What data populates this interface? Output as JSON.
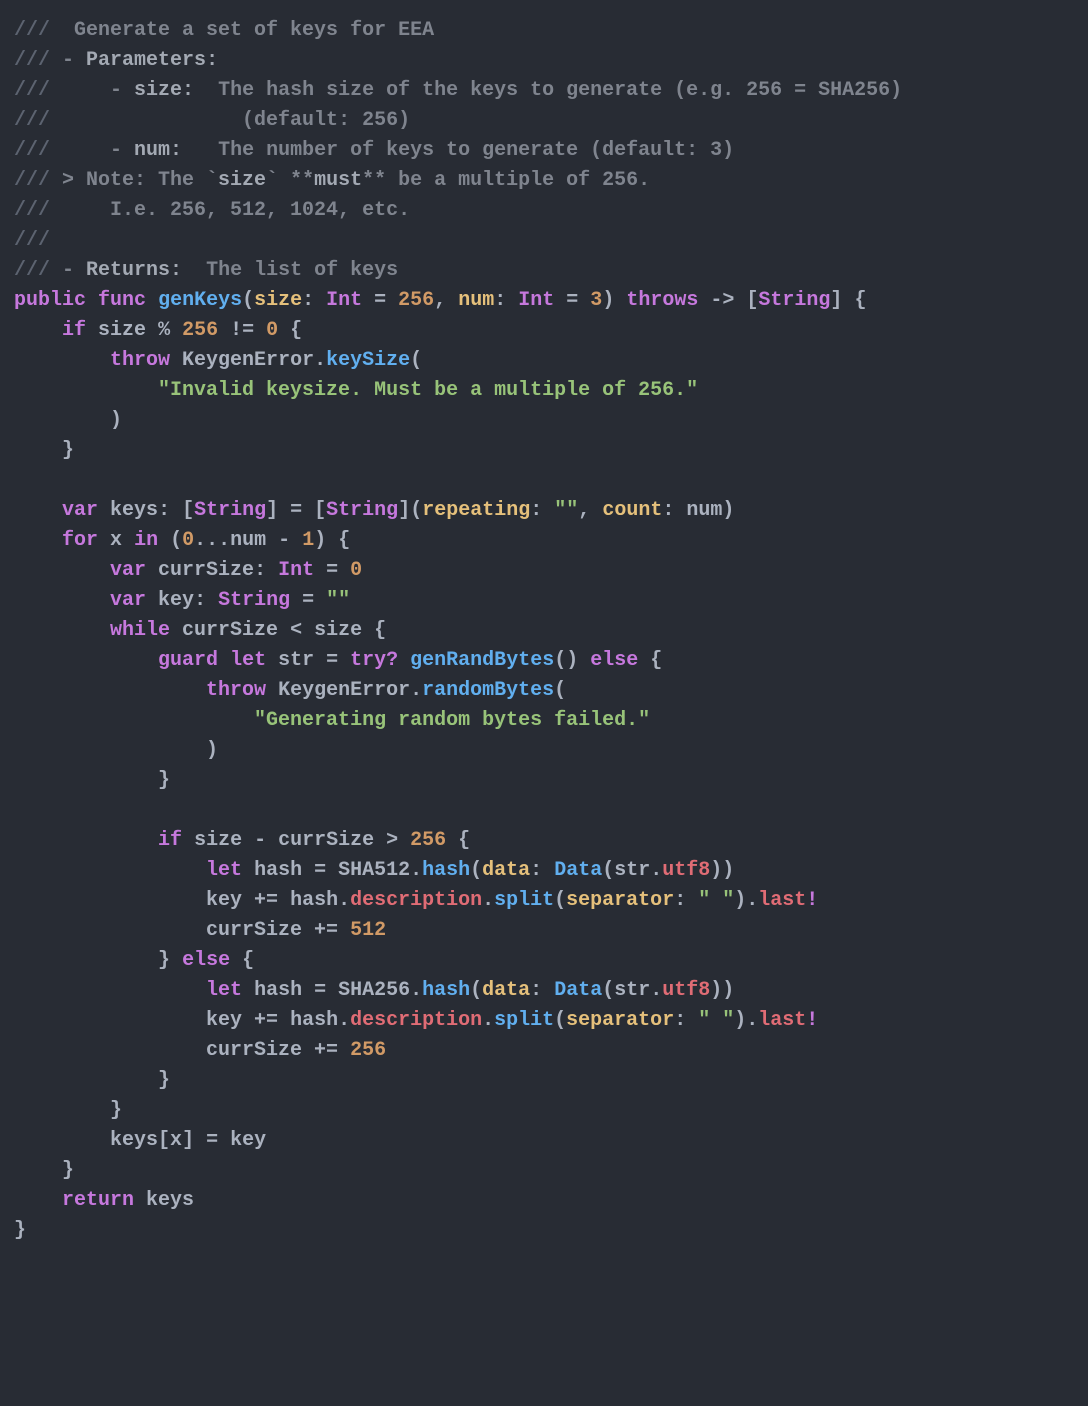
{
  "doc": {
    "l1": "  Generate a set of keys for EEA",
    "l2_dash": " - ",
    "l2_label": "Parameters",
    "l2_colon": ":",
    "l3_pre": "     - ",
    "l3_name": "size",
    "l3_colon": ":",
    "l3_desc": "  The hash size of the keys to generate (e.g. 256 = SHA256)",
    "l4_desc": "                (default: 256)",
    "l5_pre": "     - ",
    "l5_name": "num",
    "l5_colon": ":",
    "l5_desc": "   The number of keys to generate (default: 3)",
    "l6_a": " > Note: The `",
    "l6_size": "size",
    "l6_b": "` **",
    "l6_must": "must",
    "l6_c": "** be a multiple of 256.",
    "l7": "     I.e. 256, 512, 1024, etc.",
    "l9_dash": " - ",
    "l9_label": "Returns",
    "l9_colon": ":",
    "l9_desc": "  The list of keys"
  },
  "kw": {
    "public": "public",
    "func": "func",
    "Int": "Int",
    "throws": "throws",
    "String": "String",
    "if": "if",
    "throw": "throw",
    "var": "var",
    "for": "for",
    "in": "in",
    "while": "while",
    "guard": "guard",
    "let": "let",
    "try": "try",
    "else": "else",
    "return": "return"
  },
  "fn": {
    "genKeys": "genKeys",
    "keySize": "keySize",
    "genRandBytes": "genRandBytes",
    "randomBytes": "randomBytes",
    "hash": "hash",
    "Data": "Data",
    "split": "split"
  },
  "id": {
    "size": "size",
    "num": "num",
    "keys": "keys",
    "x": "x",
    "currSize": "currSize",
    "key": "key",
    "str": "str",
    "hashv": "hash",
    "KeygenError": "KeygenError",
    "SHA512": "SHA512",
    "SHA256": "SHA256",
    "description": "description",
    "last": "last",
    "utf8": "utf8",
    "repeating": "repeating",
    "count": "count",
    "data": "data",
    "separator": "separator"
  },
  "num": {
    "n256": "256",
    "n3": "3",
    "n0": "0",
    "n1": "1",
    "n512": "512"
  },
  "str": {
    "invalid": "\"Invalid keysize. Must be a multiple of 256.\"",
    "empty": "\"\"",
    "randfail": "\"Generating random bytes failed.\"",
    "space": "\" \""
  },
  "sym": {
    "slashes": "///",
    "eq": " = ",
    "arrow": " -> ",
    "pcteq": " % ",
    "neqz": " != ",
    "lt": " < ",
    "minus": " - ",
    "gt": " > ",
    "pluseq": " += ",
    "q": "?",
    "bang": "!"
  }
}
